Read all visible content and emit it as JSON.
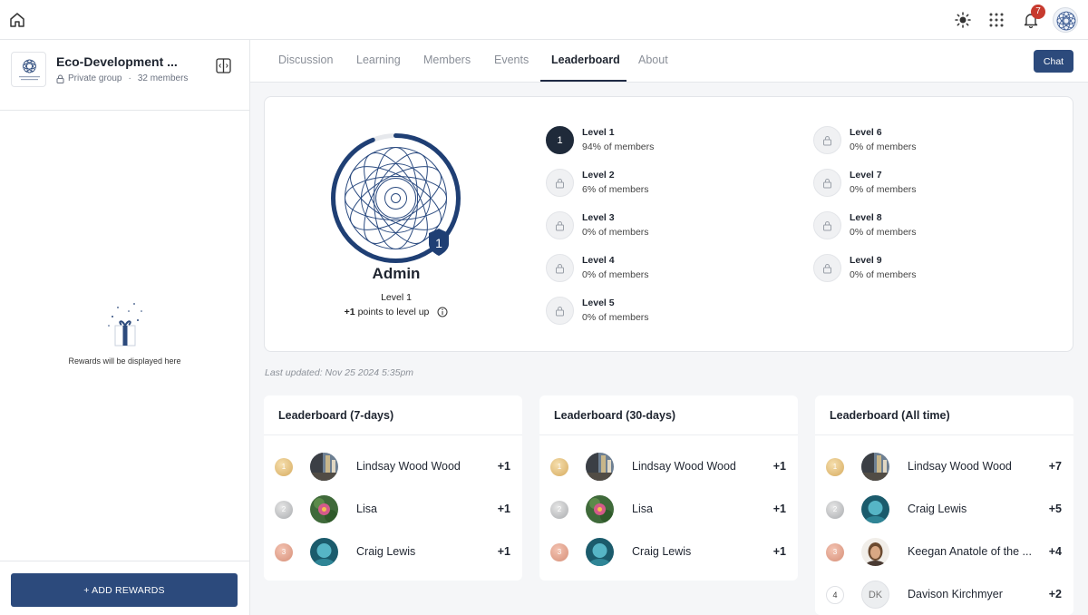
{
  "topbar": {
    "notification_count": "7"
  },
  "group": {
    "name": "Eco-Development ...",
    "privacy": "Private group",
    "member_count": "32 members"
  },
  "sidebar": {
    "rewards_empty": "Rewards will be displayed here",
    "add_rewards_label": "+ ADD REWARDS"
  },
  "tabs": [
    {
      "label": "Discussion"
    },
    {
      "label": "Learning"
    },
    {
      "label": "Members"
    },
    {
      "label": "Events"
    },
    {
      "label": "Leaderboard"
    },
    {
      "label": "About"
    }
  ],
  "active_tab": "Leaderboard",
  "chat_label": "Chat",
  "profile": {
    "name": "Admin",
    "level_badge": "1",
    "level": "Level 1",
    "points_prefix": "+1",
    "points_suffix": "points to level up",
    "progress": 0.94
  },
  "levels": [
    {
      "name": "Level 1",
      "pct": "94% of members",
      "number": "1"
    },
    {
      "name": "Level 2",
      "pct": "6% of members"
    },
    {
      "name": "Level 3",
      "pct": "0% of members"
    },
    {
      "name": "Level 4",
      "pct": "0% of members"
    },
    {
      "name": "Level 5",
      "pct": "0% of members"
    },
    {
      "name": "Level 6",
      "pct": "0% of members"
    },
    {
      "name": "Level 7",
      "pct": "0% of members"
    },
    {
      "name": "Level 8",
      "pct": "0% of members"
    },
    {
      "name": "Level 9",
      "pct": "0% of members"
    }
  ],
  "last_updated": "Last updated: Nov 25 2024 5:35pm",
  "leaderboards": [
    {
      "title": "Leaderboard (7-days)",
      "rows": [
        {
          "rank": "1",
          "name": "Lindsay Wood Wood",
          "points": "+1"
        },
        {
          "rank": "2",
          "name": "Lisa",
          "points": "+1"
        },
        {
          "rank": "3",
          "name": "Craig Lewis",
          "points": "+1"
        }
      ]
    },
    {
      "title": "Leaderboard (30-days)",
      "rows": [
        {
          "rank": "1",
          "name": "Lindsay Wood Wood",
          "points": "+1"
        },
        {
          "rank": "2",
          "name": "Lisa",
          "points": "+1"
        },
        {
          "rank": "3",
          "name": "Craig Lewis",
          "points": "+1"
        }
      ]
    },
    {
      "title": "Leaderboard (All time)",
      "rows": [
        {
          "rank": "1",
          "name": "Lindsay Wood Wood",
          "points": "+7"
        },
        {
          "rank": "2",
          "name": "Craig Lewis",
          "points": "+5"
        },
        {
          "rank": "3",
          "name": "Keegan Anatole of the ...",
          "points": "+4"
        },
        {
          "rank": "4",
          "name": "Davison Kirchmyer",
          "points": "+2",
          "initials": "DK"
        }
      ]
    }
  ],
  "colors": {
    "primary": "#2c4a7c",
    "dark": "#1f2a3a",
    "badge": "#c73a2e"
  }
}
